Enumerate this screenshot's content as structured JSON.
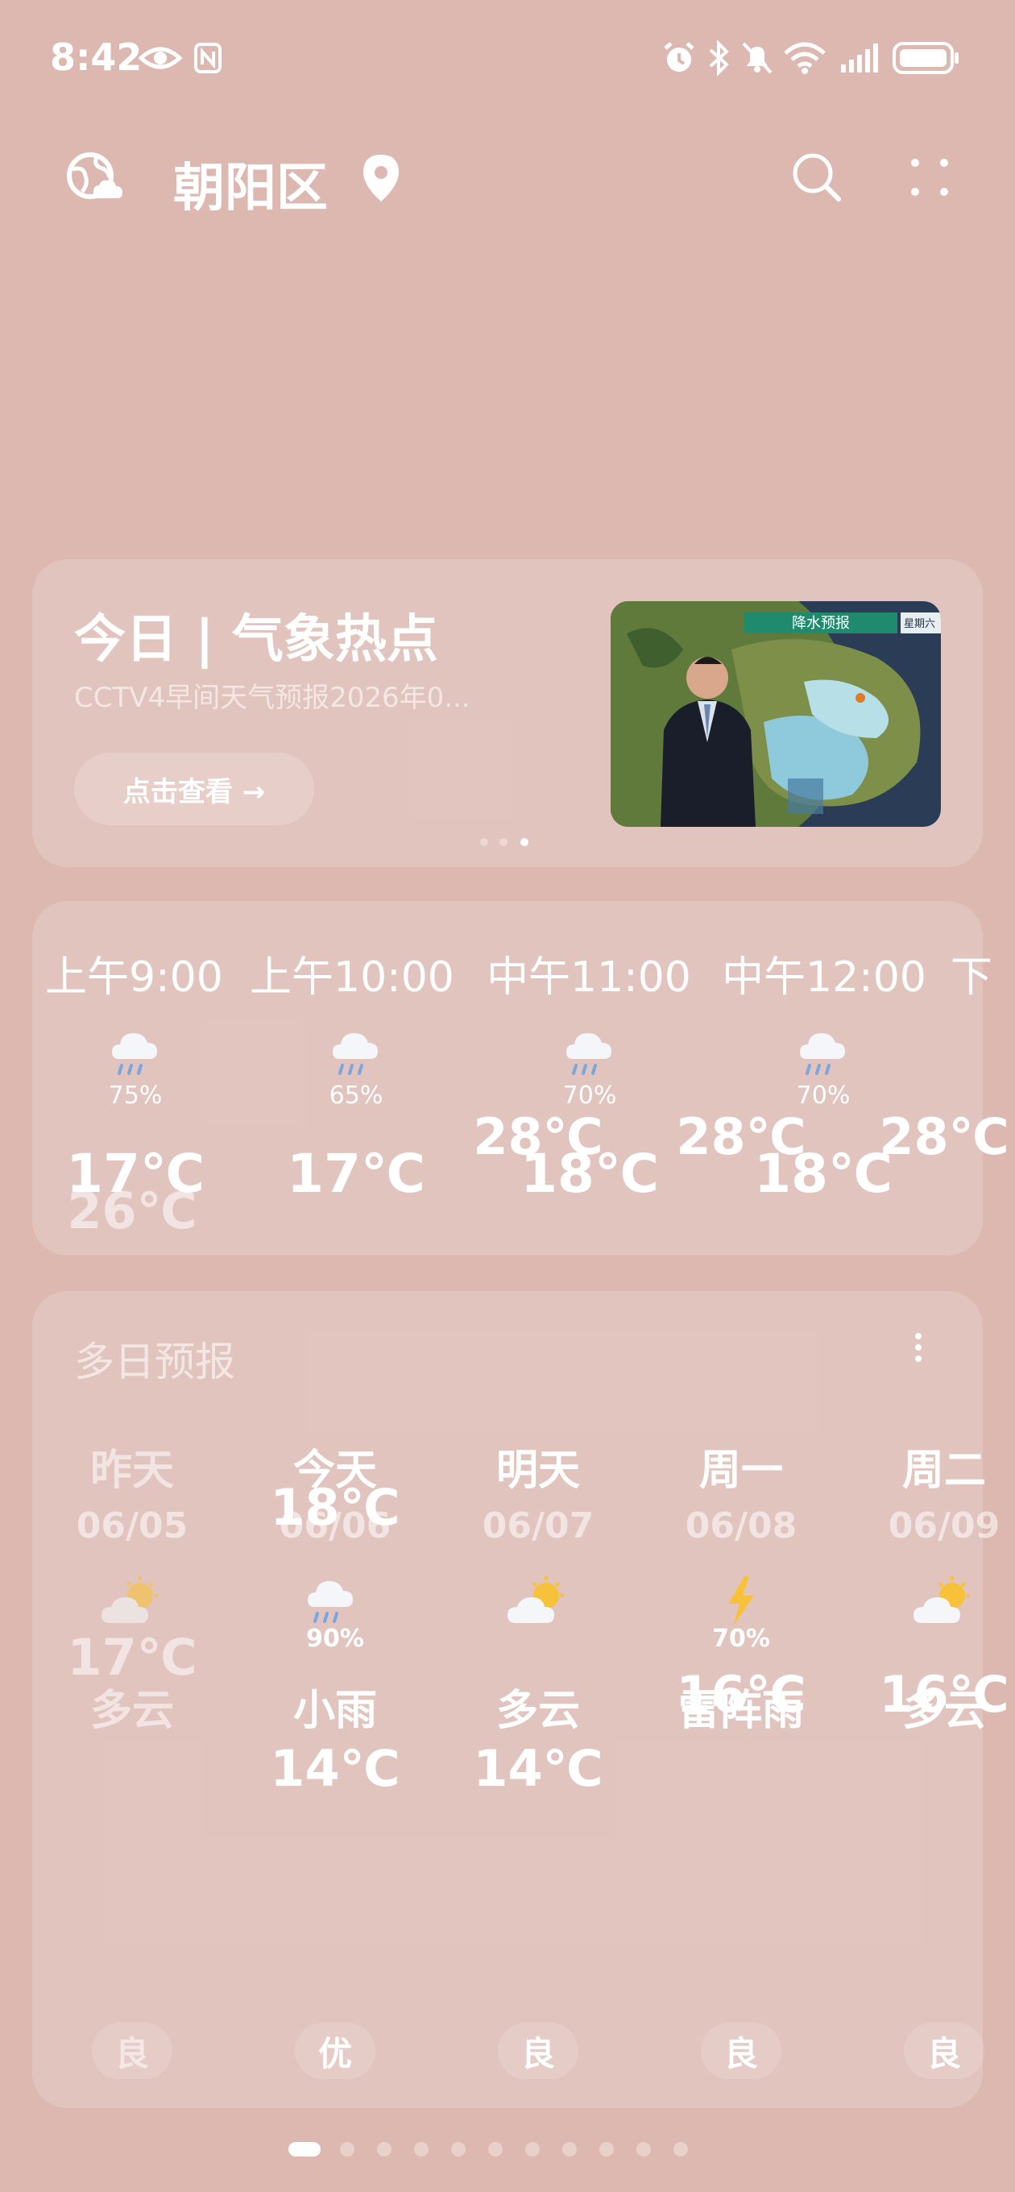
{
  "status_bar": {
    "time": "8:42",
    "icons": [
      "eye-icon",
      "nfc-icon",
      "alarm-icon",
      "bluetooth-icon",
      "mute-icon",
      "wifi-icon",
      "signal-icon",
      "battery-icon"
    ]
  },
  "header": {
    "city": "朝阳区",
    "left_icon": "globe-cloud-icon",
    "location_icon": "location-pin-icon",
    "search_icon": "search-icon",
    "more_icon": "grid-dots-icon"
  },
  "hot_topic": {
    "title": "今日 | 气象热点",
    "subtitle": "CCTV4早间天气预报2026年0...",
    "button": "点击查看 →",
    "thumb_banner": "降水预报",
    "thumb_corner": "星期六",
    "carousel_dots": 3,
    "carousel_active": 3
  },
  "hourly": [
    {
      "time": "上午9:00",
      "pct": "75%",
      "temp": "17℃",
      "icon": "rain-cloud-icon"
    },
    {
      "time": "上午10:00",
      "pct": "65%",
      "temp": "17℃",
      "icon": "rain-cloud-icon"
    },
    {
      "time": "中午11:00",
      "pct": "70%",
      "temp": "18℃",
      "icon": "rain-cloud-icon"
    },
    {
      "time": "中午12:00",
      "pct": "70%",
      "temp": "18℃",
      "icon": "rain-cloud-icon"
    },
    {
      "time": "下",
      "pct": "",
      "temp": "",
      "icon": ""
    }
  ],
  "multiday": {
    "title": "多日预报",
    "days": [
      {
        "name": "昨天",
        "date": "06/05",
        "cond": "多云",
        "pct": "",
        "hi": "26℃",
        "lo": "17℃",
        "aqi": "良",
        "icon": "partly-cloudy-icon",
        "dim": true
      },
      {
        "name": "今天",
        "date": "06/06",
        "cond": "小雨",
        "pct": "90%",
        "hi": "18℃",
        "lo": "14℃",
        "aqi": "优",
        "icon": "rain-cloud-icon",
        "dim": false
      },
      {
        "name": "明天",
        "date": "06/07",
        "cond": "多云",
        "pct": "",
        "hi": "28℃",
        "lo": "14℃",
        "aqi": "良",
        "icon": "partly-cloudy-icon",
        "dim": false
      },
      {
        "name": "周一",
        "date": "06/08",
        "cond": "雷阵雨",
        "pct": "70%",
        "hi": "28℃",
        "lo": "16℃",
        "aqi": "良",
        "icon": "lightning-icon",
        "dim": false
      },
      {
        "name": "周二",
        "date": "06/09",
        "cond": "多云",
        "pct": "",
        "hi": "28℃",
        "lo": "16℃",
        "aqi": "良",
        "icon": "partly-cloudy-icon",
        "dim": false
      }
    ]
  },
  "pager": {
    "count": 11,
    "active": 1
  }
}
